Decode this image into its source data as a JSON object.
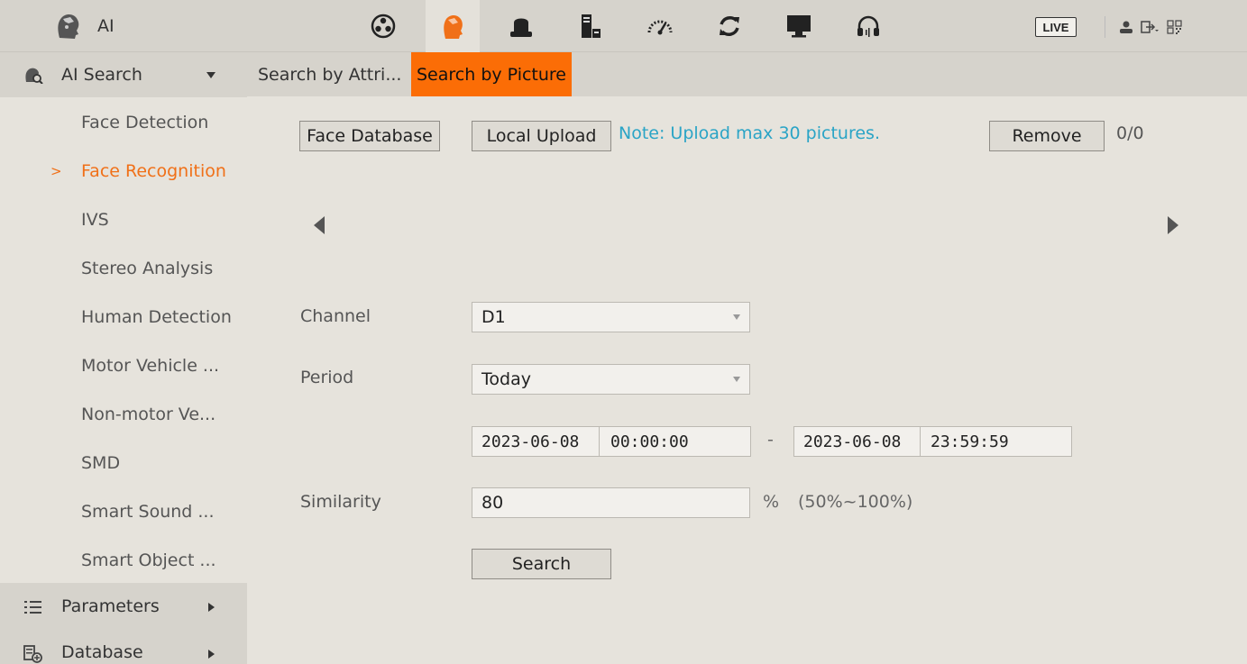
{
  "topbar": {
    "app_title": "AI",
    "live_label": "LIVE",
    "icons": [
      "film-reel-icon",
      "ai-head-icon",
      "alarm-bell-icon",
      "storage-icon",
      "gauge-icon",
      "refresh-icon",
      "monitor-icon",
      "headset-icon"
    ]
  },
  "sidebar": {
    "group_ai_search": "AI Search",
    "items": [
      {
        "label": "Face Detection"
      },
      {
        "label": "Face Recognition"
      },
      {
        "label": "IVS"
      },
      {
        "label": "Stereo Analysis"
      },
      {
        "label": "Human Detection"
      },
      {
        "label": "Motor Vehicle ..."
      },
      {
        "label": "Non-motor Ve..."
      },
      {
        "label": "SMD"
      },
      {
        "label": "Smart Sound ..."
      },
      {
        "label": "Smart Object ..."
      }
    ],
    "active_marker": ">",
    "group_parameters": "Parameters",
    "group_database": "Database"
  },
  "tabs": [
    {
      "label": "Search by Attri..."
    },
    {
      "label": "Search by Picture"
    }
  ],
  "toolbar": {
    "face_database": "Face Database",
    "local_upload": "Local Upload",
    "note": "Note: Upload max 30 pictures.",
    "remove": "Remove",
    "counter": "0/0"
  },
  "form": {
    "channel_label": "Channel",
    "channel_value": "D1",
    "period_label": "Period",
    "period_value": "Today",
    "start_date": "2023-06-08",
    "start_time": "00:00:00",
    "range_sep": "-",
    "end_date": "2023-06-08",
    "end_time": "23:59:59",
    "similarity_label": "Similarity",
    "similarity_value": "80",
    "percent": "%",
    "range_hint": "(50%~100%)",
    "search_button": "Search"
  },
  "colors": {
    "accent": "#fb6d06",
    "active_text": "#f07018",
    "note": "#2aa4c6"
  }
}
